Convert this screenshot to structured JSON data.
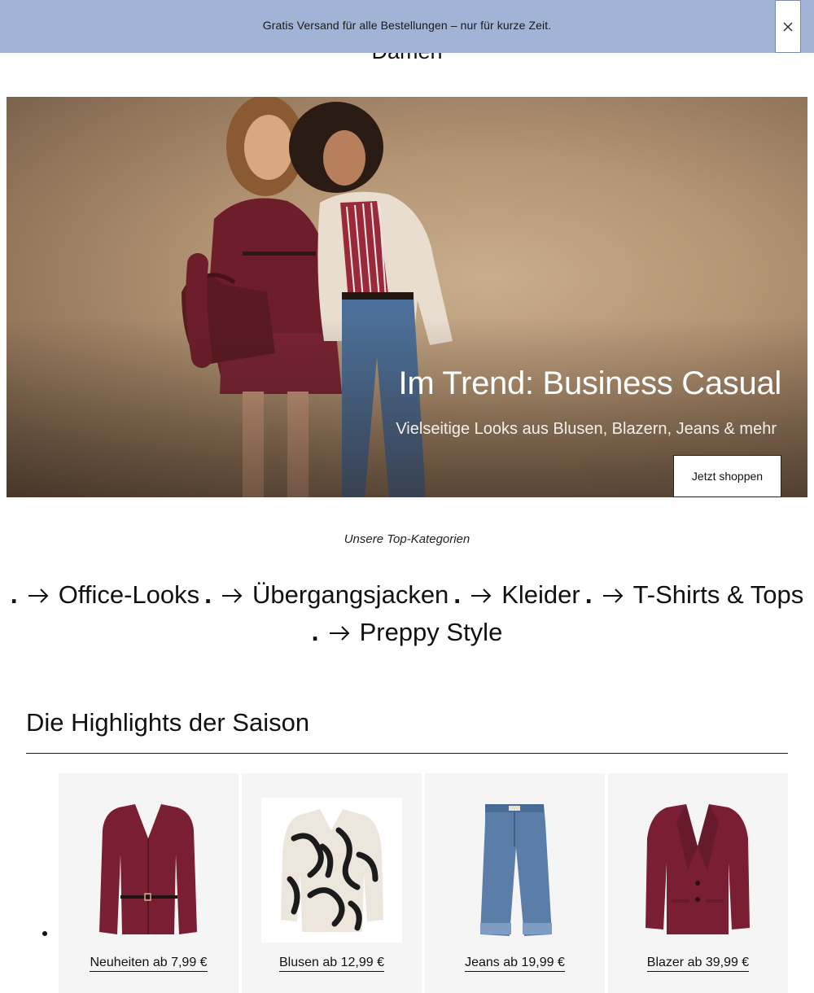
{
  "promo": {
    "text": "Gratis Versand für alle Bestellungen – nur für kurze Zeit.",
    "close_icon": "close-icon"
  },
  "page": {
    "title": "Damen"
  },
  "hero": {
    "title": "Im Trend: Business Casual",
    "subtitle": "Vielseitige Looks aus Blusen, Blazern, Jeans & mehr",
    "cta_label": "Jetzt shoppen"
  },
  "categories": {
    "heading": "Unsere Top-Kategorien",
    "items": [
      {
        "label": "Office-Looks",
        "icon": "arrow-right-icon"
      },
      {
        "label": "Übergangsjacken",
        "icon": "arrow-right-icon"
      },
      {
        "label": "Kleider",
        "icon": "arrow-right-icon"
      },
      {
        "label": "T-Shirts & Tops",
        "icon": "arrow-right-icon"
      },
      {
        "label": "Preppy Style",
        "icon": "arrow-right-icon"
      }
    ]
  },
  "highlights": {
    "title": "Die Highlights der Saison",
    "cards": [
      {
        "label": "Neuheiten ab 7,99 €",
        "image": "burgundy-cardigan"
      },
      {
        "label": "Blusen ab 12,99 €",
        "image": "zebra-print-blouse"
      },
      {
        "label": "Jeans ab 19,99 €",
        "image": "blue-jeans"
      },
      {
        "label": "Blazer ab 39,99 €",
        "image": "burgundy-blazer"
      }
    ]
  },
  "colors": {
    "promo_bg": "#a1b4d6",
    "burgundy": "#7a1f33",
    "denim": "#5b7ea8",
    "card_bg": "#f5f5f5"
  }
}
